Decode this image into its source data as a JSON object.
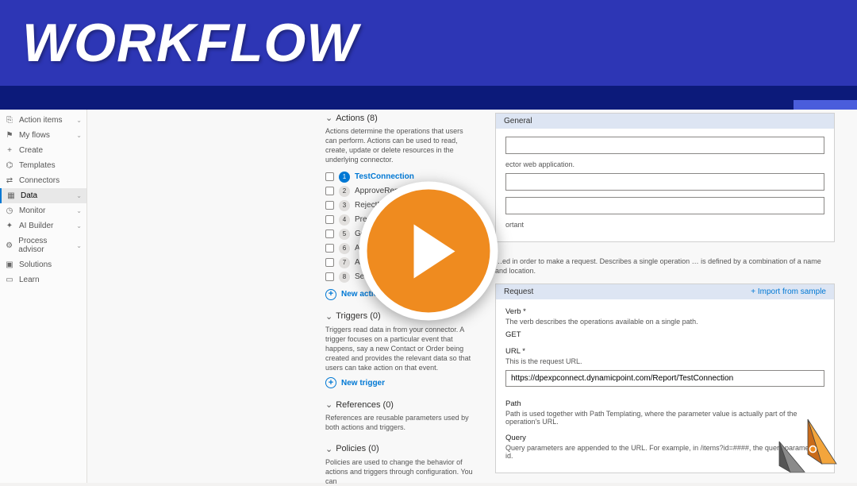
{
  "banner": {
    "title": "WORKFLOW"
  },
  "sidebar": {
    "items": [
      {
        "icon": "⎘",
        "label": "Action items",
        "chev": true
      },
      {
        "icon": "⚑",
        "label": "My flows",
        "chev": true
      },
      {
        "icon": "+",
        "label": "Create",
        "chev": false
      },
      {
        "icon": "⌬",
        "label": "Templates",
        "chev": false
      },
      {
        "icon": "⇄",
        "label": "Connectors",
        "chev": false
      },
      {
        "icon": "▦",
        "label": "Data",
        "chev": true,
        "active": true
      },
      {
        "icon": "◷",
        "label": "Monitor",
        "chev": true
      },
      {
        "icon": "✦",
        "label": "AI Builder",
        "chev": true
      },
      {
        "icon": "⚙",
        "label": "Process advisor",
        "chev": true
      },
      {
        "icon": "▣",
        "label": "Solutions",
        "chev": false
      },
      {
        "icon": "▭",
        "label": "Learn",
        "chev": false
      }
    ]
  },
  "defcol": {
    "actions": {
      "title": "Actions (8)",
      "desc": "Actions determine the operations that users can perform. Actions can be used to read, create, update or delete resources in the underlying connector.",
      "items": [
        {
          "num": "1",
          "label": "TestConnection",
          "selected": true
        },
        {
          "num": "2",
          "label": "ApproveReport"
        },
        {
          "num": "3",
          "label": "RejectReport"
        },
        {
          "num": "4",
          "label": "PreApproveR…"
        },
        {
          "num": "5",
          "label": "GetReportDa…"
        },
        {
          "num": "6",
          "label": "AddReportNa…"
        },
        {
          "num": "7",
          "label": "AddReportAud…"
        },
        {
          "num": "8",
          "label": "SetReportPer…"
        }
      ],
      "add": "New action"
    },
    "triggers": {
      "title": "Triggers (0)",
      "desc": "Triggers read data in from your connector. A trigger focuses on a particular event that happens, say a new Contact or Order being created and provides the relevant data so that users can take action on that event.",
      "add": "New trigger"
    },
    "references": {
      "title": "References (0)",
      "desc": "References are reusable parameters used by both actions and triggers."
    },
    "policies": {
      "title": "Policies (0)",
      "desc": "Policies are used to change the behavior of actions and triggers through configuration. You can"
    }
  },
  "form": {
    "general": {
      "title": "General",
      "placeholder1": "",
      "note1": "ector web application.",
      "note2": "ortant"
    },
    "between": "…ed in order to make a request. Describes a single operation … is defined by a combination of a name and location.",
    "request": {
      "title": "Request",
      "import": "+ Import from sample",
      "verb_label": "Verb *",
      "verb_desc": "The verb describes the operations available on a single path.",
      "verb_value": "GET",
      "url_label": "URL *",
      "url_desc": "This is the request URL.",
      "url_value": "https://dpexpconnect.dynamicpoint.com/Report/TestConnection",
      "path_label": "Path",
      "path_desc": "Path is used together with Path Templating, where the parameter value is actually part of the operation's URL.",
      "query_label": "Query",
      "query_desc": "Query parameters are appended to the URL. For example, in /items?id=####, the query parameter is id."
    }
  }
}
